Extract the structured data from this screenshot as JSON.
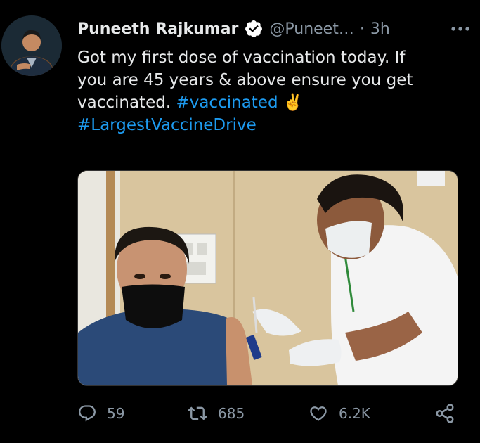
{
  "tweet": {
    "author_name": "Puneeth Rajkumar",
    "handle": "@Puneet…",
    "separator": "·",
    "time": "3h",
    "text_line1": "Got my first dose of vaccination today. If",
    "text_line2": "you are 45 years & above ensure you get",
    "text_line3_prefix": "vaccinated.",
    "hashtag1": "#vaccinated",
    "emoji": "✌️",
    "hashtag2": "#LargestVaccineDrive"
  },
  "actions": {
    "replies": "59",
    "retweets": "685",
    "likes": "6.2K"
  },
  "colors": {
    "background": "#000000",
    "link": "#1d9bf0",
    "muted": "#8b98a5",
    "verified": "#ffffff"
  },
  "icons": [
    "verified-badge-icon",
    "more-options-icon",
    "reply-icon",
    "retweet-icon",
    "like-icon",
    "share-icon"
  ]
}
